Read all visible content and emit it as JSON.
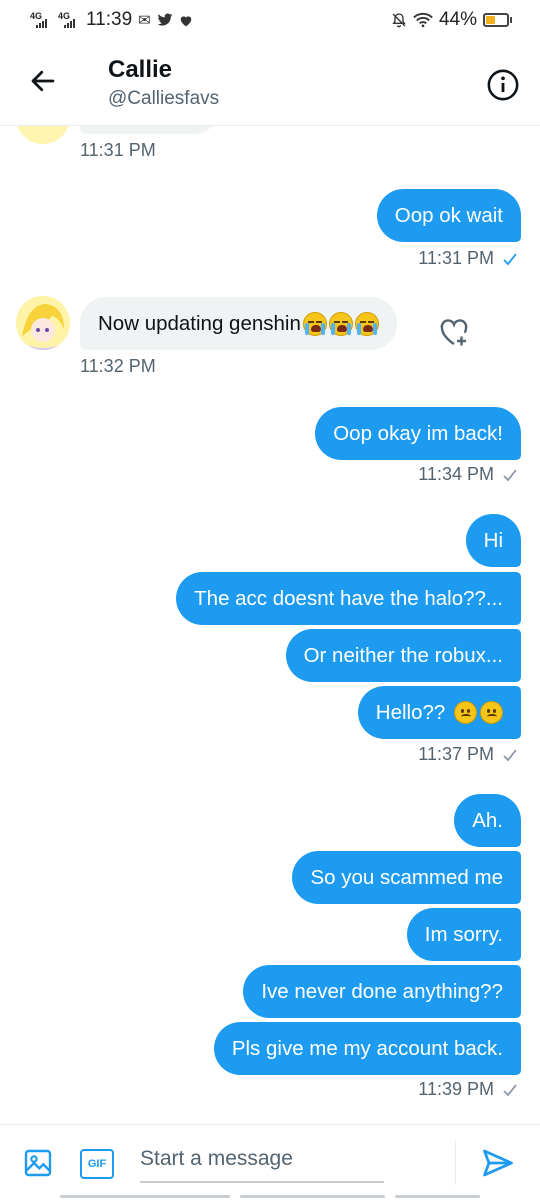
{
  "status_bar": {
    "network_1": "4G",
    "network_2": "4G",
    "time": "11:39",
    "battery": "44%",
    "battery_level": 0.44
  },
  "header": {
    "name": "Callie",
    "handle": "@Calliesfavs"
  },
  "messages": {
    "m0_time": "11:31 PM",
    "m1_text": "Oop ok wait",
    "m1_time": "11:31 PM",
    "m2_text": "Now updating genshin",
    "m2_time": "11:32 PM",
    "m3_text": "Oop okay im back!",
    "m3_time": "11:34 PM",
    "m4_text": "Hi",
    "m5_text": "The acc doesnt have the halo??...",
    "m6_text": "Or neither the robux...",
    "m7_text": "Hello??",
    "m7_time": "11:37 PM",
    "m8_text": "Ah.",
    "m9_text": "So you scammed me",
    "m10_text": "Im sorry.",
    "m11_text": "Ive never done anything??",
    "m12_text": "Pls give me my account back.",
    "m12_time": "11:39 PM"
  },
  "composer": {
    "placeholder": "Start a message",
    "gif_label": "GIF"
  },
  "colors": {
    "accent": "#1d9bf0",
    "incoming_bubble": "#eff3f4",
    "secondary_text": "#536471"
  },
  "icons": {
    "back": "arrow-left-icon",
    "info": "info-icon",
    "react": "heart-plus-icon",
    "media": "image-icon",
    "gif": "gif-icon",
    "send": "send-icon",
    "read": "checkmark-icon"
  }
}
